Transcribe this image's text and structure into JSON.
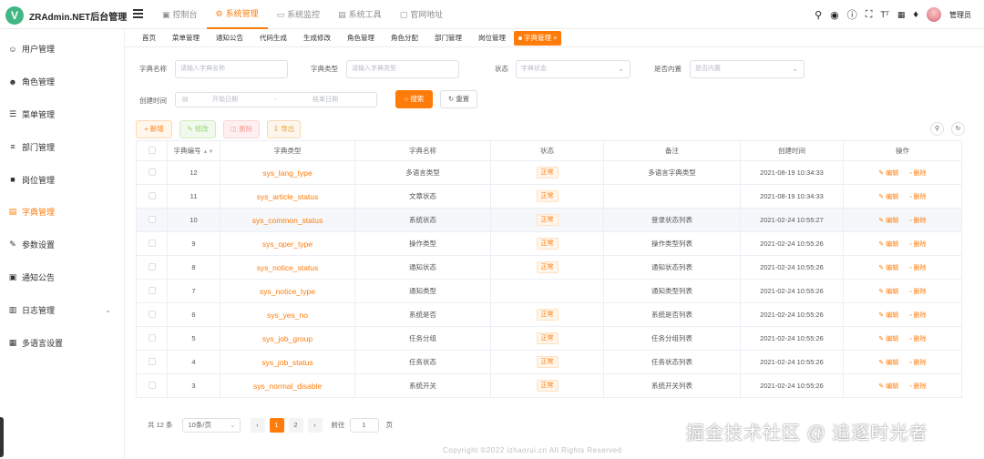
{
  "app": {
    "logo_letter": "V",
    "title": "ZRAdmin.NET后台管理"
  },
  "top_nav": [
    {
      "label": "控制台",
      "icon": "dashboard-icon",
      "active": false
    },
    {
      "label": "系统管理",
      "icon": "gear-icon",
      "active": true
    },
    {
      "label": "系统监控",
      "icon": "monitor-icon",
      "active": false
    },
    {
      "label": "系统工具",
      "icon": "tools-icon",
      "active": false
    },
    {
      "label": "官网地址",
      "icon": "link-icon",
      "active": false
    }
  ],
  "header_tools": {
    "user_name": "管理员",
    "icons": [
      "search-icon",
      "github-icon",
      "help-icon",
      "fullscreen-icon",
      "font-size-icon",
      "translate-icon",
      "bell-icon"
    ]
  },
  "sidebar": [
    {
      "label": "用户管理",
      "icon": "user-icon"
    },
    {
      "label": "角色管理",
      "icon": "role-icon"
    },
    {
      "label": "菜单管理",
      "icon": "menu-icon"
    },
    {
      "label": "部门管理",
      "icon": "dept-icon"
    },
    {
      "label": "岗位管理",
      "icon": "post-icon"
    },
    {
      "label": "字典管理",
      "icon": "dict-icon",
      "active": true
    },
    {
      "label": "参数设置",
      "icon": "edit-icon"
    },
    {
      "label": "通知公告",
      "icon": "notice-icon"
    },
    {
      "label": "日志管理",
      "icon": "log-icon",
      "has_children": true
    },
    {
      "label": "多语言设置",
      "icon": "language-icon"
    }
  ],
  "tags": [
    "首页",
    "菜单管理",
    "通知公告",
    "代码生成",
    "生成修改",
    "角色管理",
    "角色分配",
    "部门管理",
    "岗位管理",
    "字典管理"
  ],
  "search": {
    "dict_name_label": "字典名称",
    "dict_name_placeholder": "请输入字典名称",
    "dict_type_label": "字典类型",
    "dict_type_placeholder": "请输入字典类型",
    "status_label": "状态",
    "status_placeholder": "字典状态",
    "builtin_label": "是否内置",
    "builtin_placeholder": "是否内置",
    "created_label": "创建时间",
    "start_placeholder": "开始日期",
    "range_sep": "-",
    "end_placeholder": "结束日期",
    "search_btn": "搜索",
    "reset_btn": "重置"
  },
  "toolbar": {
    "add": "新增",
    "edit": "修改",
    "delete": "删除",
    "export": "导出"
  },
  "table": {
    "headers": [
      "字典编号",
      "字典类型",
      "字典名称",
      "状态",
      "备注",
      "创建时间",
      "操作"
    ],
    "edit_label": "编辑",
    "delete_label": "删除",
    "rows": [
      {
        "id": "12",
        "type": "sys_lang_type",
        "name": "多语言类型",
        "status": "正常",
        "remark": "多语言字典类型",
        "created": "2021-08-19 10:34:33"
      },
      {
        "id": "11",
        "type": "sys_article_status",
        "name": "文章状态",
        "status": "正常",
        "remark": "",
        "created": "2021-08-19 10:34:33"
      },
      {
        "id": "10",
        "type": "sys_common_status",
        "name": "系统状态",
        "status": "正常",
        "remark": "登录状态列表",
        "created": "2021-02-24 10:55:27"
      },
      {
        "id": "9",
        "type": "sys_oper_type",
        "name": "操作类型",
        "status": "正常",
        "remark": "操作类型列表",
        "created": "2021-02-24 10:55:26"
      },
      {
        "id": "8",
        "type": "sys_notice_status",
        "name": "通知状态",
        "status": "正常",
        "remark": "通知状态列表",
        "created": "2021-02-24 10:55:26"
      },
      {
        "id": "7",
        "type": "sys_notice_type",
        "name": "通知类型",
        "status": "",
        "remark": "通知类型列表",
        "created": "2021-02-24 10:55:26"
      },
      {
        "id": "6",
        "type": "sys_yes_no",
        "name": "系统是否",
        "status": "正常",
        "remark": "系统是否列表",
        "created": "2021-02-24 10:55:26"
      },
      {
        "id": "5",
        "type": "sys_job_group",
        "name": "任务分组",
        "status": "正常",
        "remark": "任务分组列表",
        "created": "2021-02-24 10:55:26"
      },
      {
        "id": "4",
        "type": "sys_job_status",
        "name": "任务状态",
        "status": "正常",
        "remark": "任务状态列表",
        "created": "2021-02-24 10:55:26"
      },
      {
        "id": "3",
        "type": "sys_normal_disable",
        "name": "系统开关",
        "status": "正常",
        "remark": "系统开关列表",
        "created": "2021-02-24 10:55:26"
      }
    ]
  },
  "pagination": {
    "total": "共 12 条",
    "page_size": "10条/页",
    "pages": [
      "1",
      "2"
    ],
    "current": "1",
    "goto_label": "前往",
    "goto_value": "1",
    "page_unit": "页"
  },
  "footer": "Copyright ©2022 izhaorui.cn All Rights Reserved",
  "watermark": "掘金技术社区 @ 追逐时光者"
}
